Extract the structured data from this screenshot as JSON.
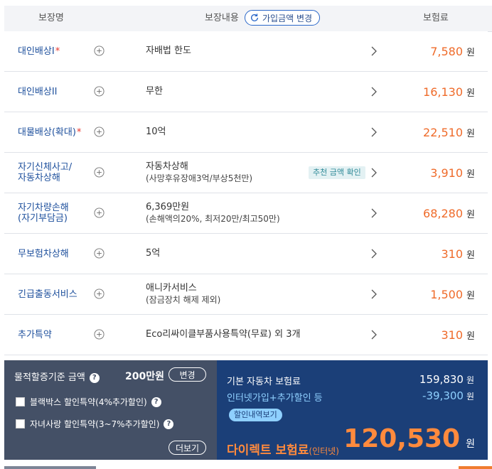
{
  "header": {
    "col_name": "보장명",
    "col_content": "보장내용",
    "change_button": "가입금액 변경",
    "col_premium": "보험료"
  },
  "rows": [
    {
      "name": "대인배상I",
      "required": "*",
      "content": "자배법 한도",
      "sub": "",
      "badge": "",
      "premium": "7,580",
      "unit": "원"
    },
    {
      "name": "대인배상II",
      "required": "",
      "content": "무한",
      "sub": "",
      "badge": "",
      "premium": "16,130",
      "unit": "원"
    },
    {
      "name": "대물배상(확대)",
      "required": "*",
      "content": "10억",
      "sub": "",
      "badge": "",
      "premium": "22,510",
      "unit": "원"
    },
    {
      "name": "자기신체사고/",
      "name2": "자동차상해",
      "required": "",
      "content": "자동차상해",
      "sub": "(사망후유장애3억/부상5천만)",
      "badge": "추천 금액 확인",
      "premium": "3,910",
      "unit": "원"
    },
    {
      "name": "자기차량손해",
      "name2": "(자기부담금)",
      "required": "",
      "content": "6,369만원",
      "sub": "(손해액의20%, 최저20만/최고50만)",
      "badge": "",
      "premium": "68,280",
      "unit": "원"
    },
    {
      "name": "무보험차상해",
      "required": "",
      "content": "5억",
      "sub": "",
      "badge": "",
      "premium": "310",
      "unit": "원"
    },
    {
      "name": "긴급출동서비스",
      "required": "",
      "content": "애니카서비스",
      "sub": "(잠금장치 해제 제외)",
      "badge": "",
      "premium": "1,500",
      "unit": "원"
    },
    {
      "name": "추가특약",
      "required": "",
      "content": "Eco리싸이클부품사용특약(무료) 외 3개",
      "sub": "",
      "badge": "",
      "premium": "310",
      "unit": "원"
    }
  ],
  "left_panel": {
    "title": "물적할증기준 금액",
    "amount": "200만원",
    "change_button": "변경",
    "option1": "블랙박스 할인특약(4%추가할인)",
    "option2": "자녀사랑 할인특약(3~7%추가할인)",
    "more_button": "더보기"
  },
  "right_panel": {
    "base_label": "기본 자동차 보험료",
    "base_value": "159,830",
    "discount_label": "인터넷가입+추가할인 등",
    "discount_value": "-39,300",
    "discount_detail_button": "할인내역보기",
    "final_label": "다이렉트 보험료",
    "final_label_small": "(인터넷)",
    "final_value": "120,530",
    "unit": "원"
  },
  "colors": {
    "accent_orange": "#ef6b2a",
    "name_blue": "#1d4f9c",
    "panel_left": "#445066",
    "panel_right": "#1b3f78"
  }
}
